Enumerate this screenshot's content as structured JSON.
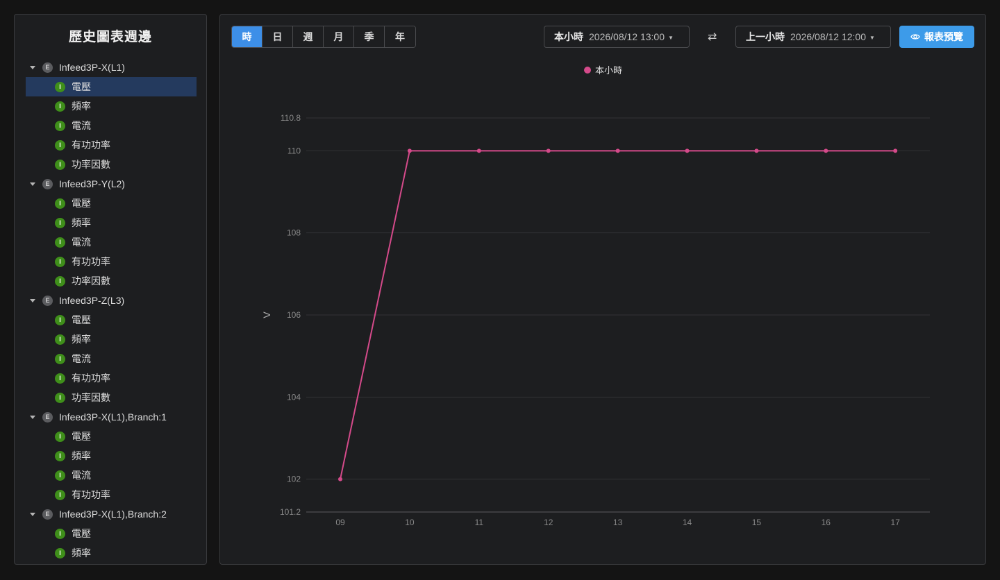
{
  "sidebar": {
    "title": "歷史圖表週邊",
    "groups": [
      {
        "label": "Infeed3P-X(L1)",
        "badge": "E",
        "items": [
          "電壓",
          "頻率",
          "電流",
          "有功功率",
          "功率因數"
        ]
      },
      {
        "label": "Infeed3P-Y(L2)",
        "badge": "E",
        "items": [
          "電壓",
          "頻率",
          "電流",
          "有功功率",
          "功率因數"
        ]
      },
      {
        "label": "Infeed3P-Z(L3)",
        "badge": "E",
        "items": [
          "電壓",
          "頻率",
          "電流",
          "有功功率",
          "功率因數"
        ]
      },
      {
        "label": "Infeed3P-X(L1),Branch:1",
        "badge": "E",
        "items": [
          "電壓",
          "頻率",
          "電流",
          "有功功率"
        ]
      },
      {
        "label": "Infeed3P-X(L1),Branch:2",
        "badge": "E",
        "items": [
          "電壓",
          "頻率"
        ]
      }
    ],
    "item_badge": "I",
    "selected": "0.0"
  },
  "toolbar": {
    "periods": [
      "時",
      "日",
      "週",
      "月",
      "季",
      "年"
    ],
    "active_period": "時",
    "current": {
      "label": "本小時",
      "value": "2026/08/12 13:00"
    },
    "swap_icon": "⇄",
    "compare": {
      "label": "上一小時",
      "value": "2026/08/12 12:00"
    },
    "preview_label": "報表預覽"
  },
  "colors": {
    "accent": "#3d9be9",
    "series": "#d44a8a",
    "badge_i": "#3f8f1a"
  },
  "chart_data": {
    "type": "line",
    "ylabel": "V",
    "xlabel": "",
    "categories": [
      "09",
      "10",
      "11",
      "12",
      "13",
      "14",
      "15",
      "16",
      "17"
    ],
    "series": [
      {
        "name": "本小時",
        "values": [
          102,
          110,
          110,
          110,
          110,
          110,
          110,
          110,
          110
        ]
      }
    ],
    "ylim": [
      101.2,
      110.8
    ],
    "yticks": [
      101.2,
      102,
      104,
      106,
      108,
      110,
      110.8
    ],
    "legend": "top-center",
    "grid": true
  }
}
